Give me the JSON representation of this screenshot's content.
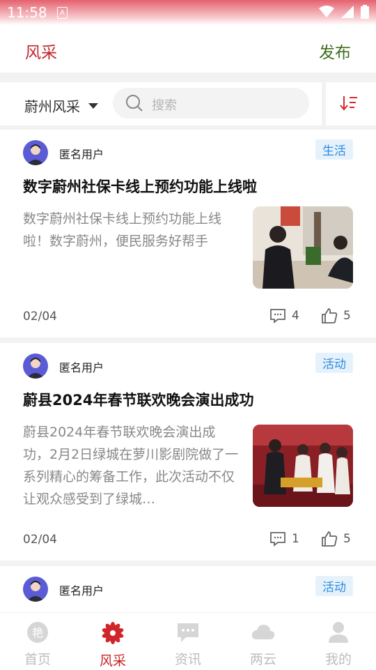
{
  "status_bar": {
    "time": "11:58",
    "sim_label": "A"
  },
  "header": {
    "title": "风采",
    "publish_label": "发布"
  },
  "filter": {
    "region": "蔚州风采",
    "search_placeholder": "搜索"
  },
  "posts": [
    {
      "user": "匿名用户",
      "tag": "生活",
      "title": "数字蔚州社保卡线上预约功能上线啦",
      "excerpt": "数字蔚州社保卡线上预约功能上线啦！数字蔚州，便民服务好帮手",
      "date": "02/04",
      "comments": "4",
      "likes": "5"
    },
    {
      "user": "匿名用户",
      "tag": "活动",
      "title": "蔚县2024年春节联欢晚会演出成功",
      "excerpt": "蔚县2024年春节联欢晚会演出成功，2月2日绿城在萝川影剧院做了一系列精心的筹备工作，此次活动不仅让观众感受到了绿城…",
      "date": "02/04",
      "comments": "1",
      "likes": "5"
    },
    {
      "user": "匿名用户",
      "tag": "活动"
    }
  ],
  "tabs": [
    {
      "label": "首页",
      "icon": "home-icon"
    },
    {
      "label": "风采",
      "icon": "flower-icon"
    },
    {
      "label": "资讯",
      "icon": "message-icon"
    },
    {
      "label": "两云",
      "icon": "cloud-icon"
    },
    {
      "label": "我的",
      "icon": "user-icon"
    }
  ],
  "colors": {
    "brand_red": "#c91f23",
    "publish_green": "#3d6e1e",
    "tag_blue": "#2b8be0"
  }
}
